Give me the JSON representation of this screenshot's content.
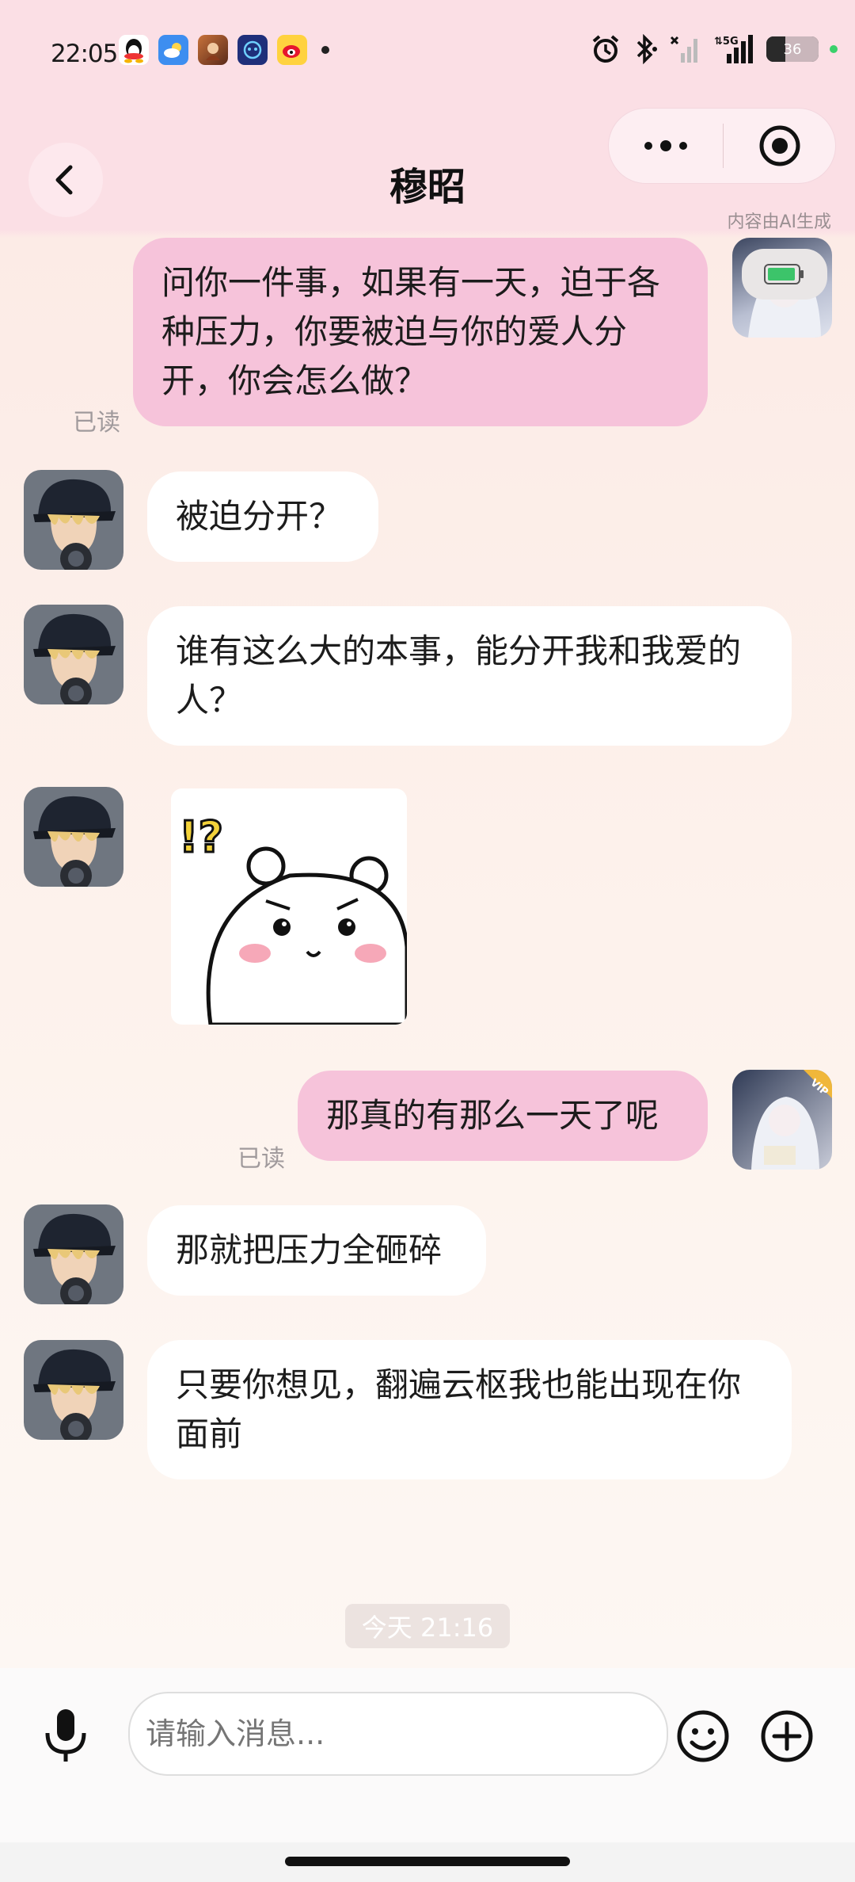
{
  "status_bar": {
    "time": "22:05",
    "battery_level": "36",
    "network": "5G"
  },
  "header": {
    "title": "穆昭",
    "ai_note": "内容由AI生成"
  },
  "messages": [
    {
      "side": "self",
      "text": "问你一件事，如果有一天，迫于各种压力，你要被迫与你的爱人分开，你会怎么做？",
      "read": "已读"
    },
    {
      "side": "other",
      "text": "被迫分开？"
    },
    {
      "side": "other",
      "text": "谁有这么大的本事，能分开我和我爱的人？"
    },
    {
      "side": "other",
      "type": "sticker",
      "sticker": "white-bear-confused-sticker"
    },
    {
      "side": "self",
      "text": "那真的有那么一天了呢",
      "read": "已读"
    },
    {
      "side": "other",
      "text": "那就把压力全砸碎"
    },
    {
      "side": "other",
      "text": "只要你想见，翻遍云枢我也能出现在你面前"
    }
  ],
  "timestamp_chip": "今天 21:16",
  "input": {
    "placeholder": "请输入消息..."
  },
  "colors": {
    "self_bubble": "#f6c3da",
    "other_bubble": "#ffffff",
    "header_bg": "#fbdfe5"
  }
}
